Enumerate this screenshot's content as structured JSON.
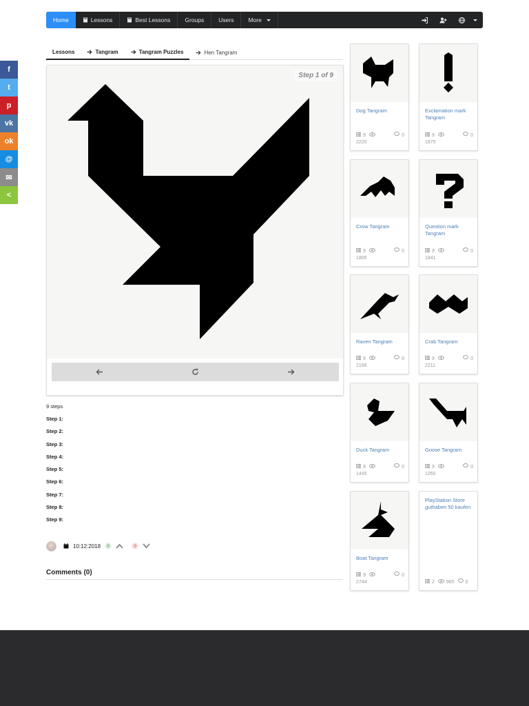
{
  "nav": {
    "home": "Home",
    "lessons": "Lessons",
    "best_lessons": "Best Lessons",
    "groups": "Groups",
    "users": "Users",
    "more": "More"
  },
  "social": [
    {
      "name": "facebook",
      "glyph": "f",
      "color": "#3b5998"
    },
    {
      "name": "twitter",
      "glyph": "t",
      "color": "#55acee"
    },
    {
      "name": "pinterest",
      "glyph": "p",
      "color": "#cb2027"
    },
    {
      "name": "vk",
      "glyph": "vk",
      "color": "#4c75a3"
    },
    {
      "name": "odnoklassniki",
      "glyph": "ok",
      "color": "#ed812b"
    },
    {
      "name": "mail",
      "glyph": "@",
      "color": "#168de2"
    },
    {
      "name": "email",
      "glyph": "✉",
      "color": "#8c8c8c"
    },
    {
      "name": "share",
      "glyph": "<",
      "color": "#8cc63e"
    }
  ],
  "breadcrumb": {
    "items": [
      "Lessons",
      "Tangram",
      "Tangram Puzzles",
      "Hen Tangram"
    ]
  },
  "viewer": {
    "step_label": "Step 1 of 9"
  },
  "steps": {
    "count": "9 steps",
    "items": [
      "Step 1:",
      "Step 2:",
      "Step 3:",
      "Step 4:",
      "Step 5:",
      "Step 6:",
      "Step 7:",
      "Step 8:",
      "Step 9:"
    ]
  },
  "meta": {
    "date": "10:12:2018",
    "upvotes": "0",
    "downvotes": "0"
  },
  "comments": {
    "title": "Comments (0)"
  },
  "sidebar": {
    "cards": [
      {
        "title": "Dog Tangram",
        "steps": "9",
        "views": "2220",
        "comments": "0"
      },
      {
        "title": "Exclamation mark Tangram",
        "steps": "9",
        "views": "1875",
        "comments": "0"
      },
      {
        "title": "Crow Tangram",
        "steps": "9",
        "views": "1805",
        "comments": "0"
      },
      {
        "title": "Question mark Tangram",
        "steps": "9",
        "views": "1841",
        "comments": "0"
      },
      {
        "title": "Raven Tangram",
        "steps": "9",
        "views": "2166",
        "comments": "0"
      },
      {
        "title": "Crab Tangram",
        "steps": "9",
        "views": "2211",
        "comments": "0"
      },
      {
        "title": "Duck Tangram",
        "steps": "9",
        "views": "1445",
        "comments": "0"
      },
      {
        "title": "Goose Tangram",
        "steps": "9",
        "views": "1260",
        "comments": "0"
      },
      {
        "title": "Boat Tangram",
        "steps": "9",
        "views": "2744",
        "comments": "0"
      },
      {
        "title": "PlayStation Store guthaben 50 kaufen",
        "steps": "2",
        "views": "965",
        "comments": "0"
      }
    ]
  }
}
